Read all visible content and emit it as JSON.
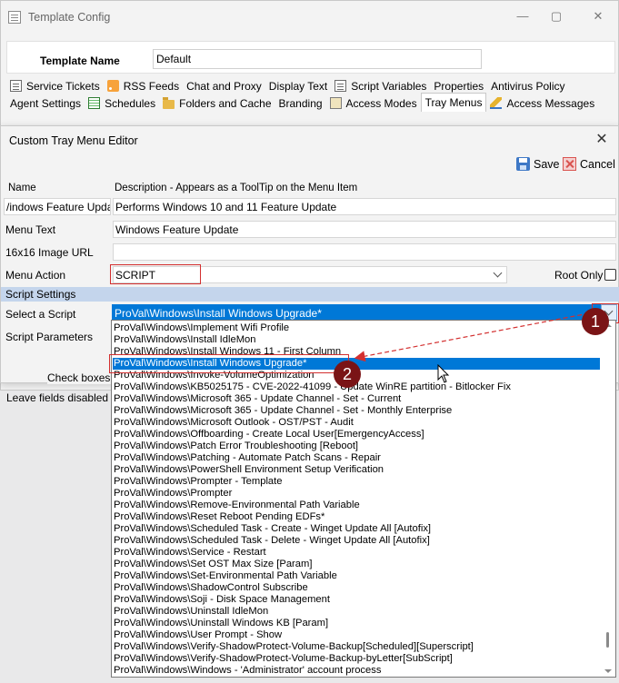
{
  "outer": {
    "title": "Template Config",
    "template_name_label": "Template Name",
    "template_name_value": "Default",
    "tabs_row1": [
      {
        "label": "Service Tickets",
        "icon": "document-icon"
      },
      {
        "label": "RSS Feeds",
        "icon": "rss-icon"
      },
      {
        "label": "Chat and Proxy",
        "icon": ""
      },
      {
        "label": "Display Text",
        "icon": ""
      },
      {
        "label": "Script Variables",
        "icon": "document-icon"
      },
      {
        "label": "Properties",
        "icon": ""
      },
      {
        "label": "Antivirus Policy",
        "icon": ""
      }
    ],
    "tabs_row2": [
      {
        "label": "Agent Settings",
        "icon": ""
      },
      {
        "label": "Schedules",
        "icon": "grid-icon"
      },
      {
        "label": "Folders and Cache",
        "icon": "folder-icon"
      },
      {
        "label": "Branding",
        "icon": ""
      },
      {
        "label": "Access Modes",
        "icon": "access-icon"
      },
      {
        "label": "Tray Menus",
        "icon": ""
      },
      {
        "label": "Access Messages",
        "icon": "pencil-icon"
      }
    ],
    "background_text_1": "Check boxes t",
    "background_text_2": "Leave fields disabled to"
  },
  "dialog": {
    "title": "Custom Tray Menu Editor",
    "save_label": "Save",
    "cancel_label": "Cancel",
    "col_name_header": "Name",
    "col_desc_header": "Description - Appears as a ToolTip on the Menu Item",
    "name_value": "/indows Feature Update",
    "desc_value": "Performs Windows 10 and 11 Feature Update",
    "menu_text_label": "Menu Text",
    "menu_text_value": "Windows Feature Update",
    "image_url_label": "16x16 Image URL",
    "image_url_value": "",
    "menu_action_label": "Menu Action",
    "menu_action_value": "SCRIPT",
    "root_only_label": "Root Only",
    "root_only_checked": false,
    "script_settings_label": "Script Settings",
    "select_script_label": "Select a Script",
    "select_script_value": "ProVal\\Windows\\Install Windows Upgrade*",
    "script_params_label": "Script Parameters"
  },
  "dropdown": {
    "items": [
      "ProVal\\Windows\\Implement Wifi Profile",
      "ProVal\\Windows\\Install IdleMon",
      "ProVal\\Windows\\Install Windows 11 - First Column",
      "ProVal\\Windows\\Install Windows Upgrade*",
      "ProVal\\Windows\\Invoke-VolumeOptimization",
      "ProVal\\Windows\\KB5025175 - CVE-2022-41099 - Update WinRE partition - Bitlocker Fix",
      "ProVal\\Windows\\Microsoft 365 - Update Channel - Set - Current",
      "ProVal\\Windows\\Microsoft 365 - Update Channel - Set - Monthly Enterprise",
      "ProVal\\Windows\\Microsoft Outlook - OST/PST - Audit",
      "ProVal\\Windows\\Offboarding - Create Local User[EmergencyAccess]",
      "ProVal\\Windows\\Patch Error Troubleshooting [Reboot]",
      "ProVal\\Windows\\Patching - Automate Patch Scans - Repair",
      "ProVal\\Windows\\PowerShell Environment Setup Verification",
      "ProVal\\Windows\\Prompter - Template",
      "ProVal\\Windows\\Prompter",
      "ProVal\\Windows\\Remove-Environmental Path Variable",
      "ProVal\\Windows\\Reset Reboot Pending EDFs*",
      "ProVal\\Windows\\Scheduled Task - Create - Winget Update All [Autofix]",
      "ProVal\\Windows\\Scheduled Task - Delete - Winget Update All [Autofix]",
      "ProVal\\Windows\\Service - Restart",
      "ProVal\\Windows\\Set OST Max Size [Param]",
      "ProVal\\Windows\\Set-Environmental Path Variable",
      "ProVal\\Windows\\ShadowControl Subscribe",
      "ProVal\\Windows\\Soji - Disk Space Management",
      "ProVal\\Windows\\Uninstall IdleMon",
      "ProVal\\Windows\\Uninstall Windows KB [Param]",
      "ProVal\\Windows\\User Prompt - Show",
      "ProVal\\Windows\\Verify-ShadowProtect-Volume-Backup[Scheduled][Superscript]",
      "ProVal\\Windows\\Verify-ShadowProtect-Volume-Backup-byLetter[SubScript]",
      "ProVal\\Windows\\Windows - 'Administrator' account process"
    ],
    "selected_index": 3
  },
  "annotations": {
    "badge1": "1",
    "badge2": "2",
    "color": "#d32f2f"
  }
}
